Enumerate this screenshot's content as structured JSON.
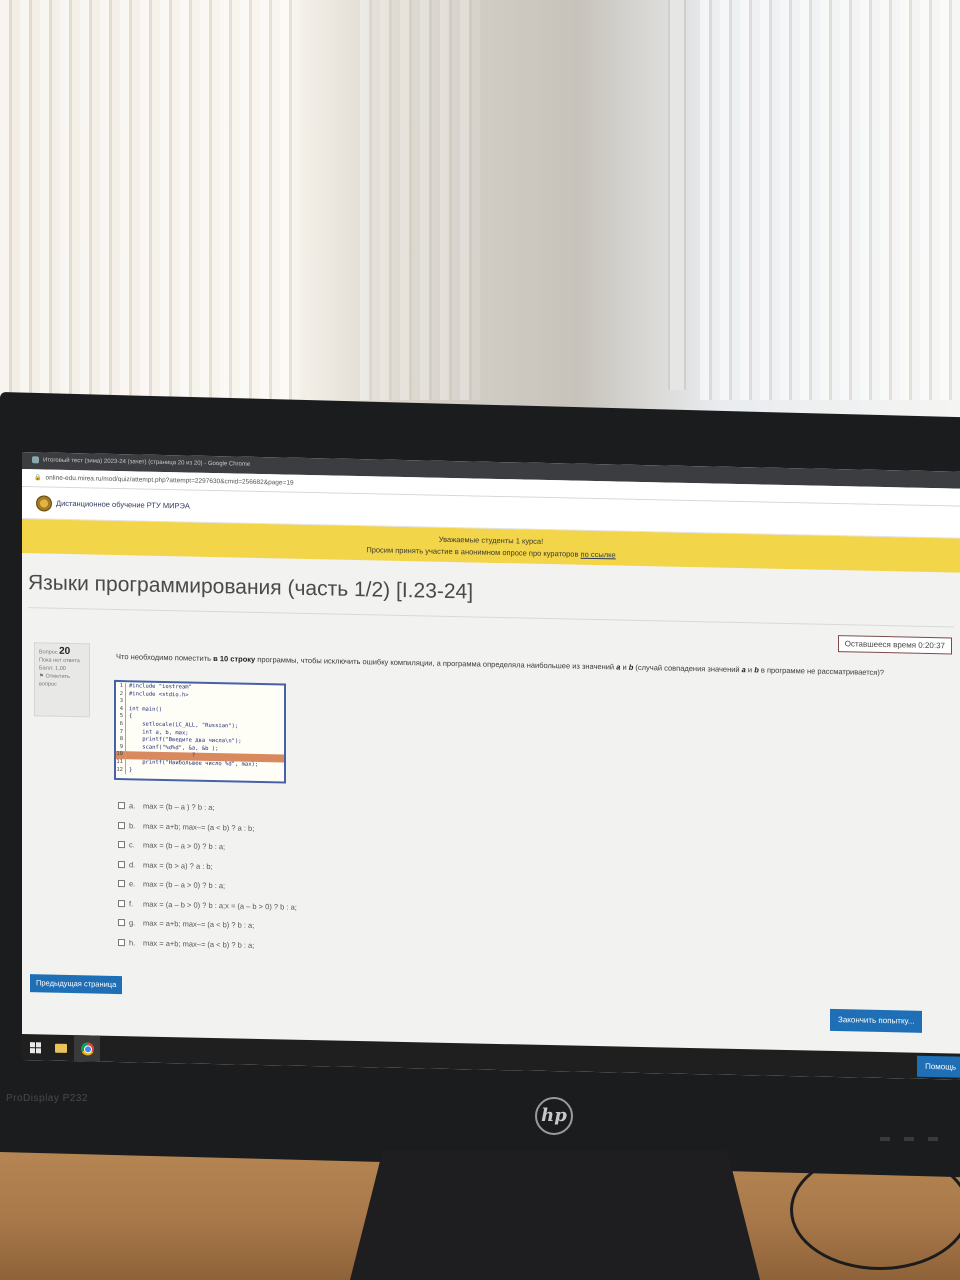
{
  "browser": {
    "window_title": "Итоговый тест (зима) 2023-24 (зачет) (страница 20 из 20) - Google Chrome",
    "url": "online-edu.mirea.ru/mod/quiz/attempt.php?attempt=2297630&cmid=256682&page=19"
  },
  "site": {
    "name": "Дистанционное обучение РТУ МИРЭА"
  },
  "notice": {
    "line1": "Уважаемые студенты 1 курса!",
    "line2_prefix": "Просим принять участие в анонимном опросе про кураторов ",
    "link": "по ссылке"
  },
  "course": {
    "title": "Языки программирования (часть 1/2) [I.23-24]"
  },
  "timer": {
    "label": "Оставшееся время 0:20:37"
  },
  "question_info": {
    "label": "Вопрос",
    "number": "20",
    "status": "Пока нет ответа",
    "points": "Балл: 1,00",
    "flag": "Отметить вопрос"
  },
  "question": {
    "text_1": "Что необходимо поместить ",
    "text_bold_1": "в 10 строку",
    "text_2": " программы, чтобы исключить ошибку компиляции, а программа определяла наибольшее из значений ",
    "var_a": "a",
    "text_and": " и ",
    "var_b": "b",
    "text_3": " (случай совпадения значений ",
    "var_a2": "a",
    "text_and2": " и ",
    "var_b2": "b",
    "text_4": " в программе не рассматривается)?"
  },
  "code": [
    {
      "n": "1",
      "text": "#include \"iostream\""
    },
    {
      "n": "2",
      "text": "#include <stdio.h>"
    },
    {
      "n": "3",
      "text": ""
    },
    {
      "n": "4",
      "text": "int main()"
    },
    {
      "n": "5",
      "text": "{"
    },
    {
      "n": "6",
      "text": "    setlocale(LC_ALL, \"Russian\");"
    },
    {
      "n": "7",
      "text": "    int a, b, max;"
    },
    {
      "n": "8",
      "text": "    printf(\"Введите два числа\\n\");"
    },
    {
      "n": "9",
      "text": "    scanf(\"%d%d\", &a, &b );"
    },
    {
      "n": "10",
      "text": "                   ?"
    },
    {
      "n": "11",
      "text": "    printf(\"Наибольшее число %d\", max);"
    },
    {
      "n": "12",
      "text": "}"
    }
  ],
  "answers": [
    {
      "letter": "a.",
      "text": "max = (b – a ) ? b : a;"
    },
    {
      "letter": "b.",
      "text": "max = a+b; max–= (a < b) ? a : b;"
    },
    {
      "letter": "c.",
      "text": "max = (b – a > 0) ? b : a;"
    },
    {
      "letter": "d.",
      "text": "max = (b > a) ? a : b;"
    },
    {
      "letter": "e.",
      "text": "max = (b – a > 0) ? b : a;"
    },
    {
      "letter": "f.",
      "text": "max = (a – b > 0) ? b : a;x = (a – b > 0) ? b : a;"
    },
    {
      "letter": "g.",
      "text": "max = a+b; max–= (a < b) ? b : a;"
    },
    {
      "letter": "h.",
      "text": "max = a+b; max–= (a < b) ? b : a;"
    }
  ],
  "buttons": {
    "prev_page": "Предыдущая страница",
    "finish": "Закончить попытку...",
    "help": "Помощь"
  },
  "monitor": {
    "model": "ProDisplay P232",
    "brand": "hp"
  }
}
